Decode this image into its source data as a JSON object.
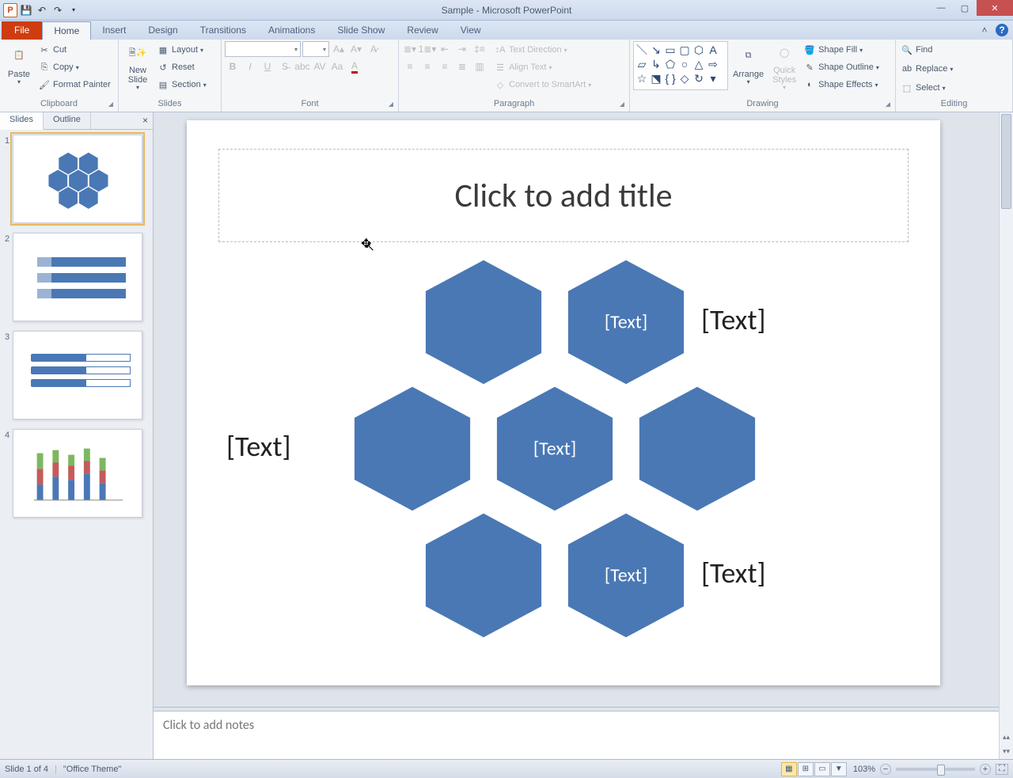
{
  "app": {
    "title": "Sample - Microsoft PowerPoint",
    "qat": {
      "save": "💾",
      "undo": "↶",
      "redo": "↷"
    }
  },
  "tabs": {
    "file": "File",
    "items": [
      "Home",
      "Insert",
      "Design",
      "Transitions",
      "Animations",
      "Slide Show",
      "Review",
      "View"
    ],
    "active": "Home"
  },
  "ribbon": {
    "clipboard": {
      "label": "Clipboard",
      "paste": "Paste",
      "cut": "Cut",
      "copy": "Copy",
      "formatpainter": "Format Painter"
    },
    "slides": {
      "label": "Slides",
      "newslide": "New\nSlide",
      "layout": "Layout",
      "reset": "Reset",
      "section": "Section"
    },
    "font": {
      "label": "Font"
    },
    "paragraph": {
      "label": "Paragraph",
      "textdir": "Text Direction",
      "align": "Align Text",
      "smartart": "Convert to SmartArt"
    },
    "drawing": {
      "label": "Drawing",
      "arrange": "Arrange",
      "quick": "Quick\nStyles",
      "fill": "Shape Fill",
      "outline": "Shape Outline",
      "effects": "Shape Effects"
    },
    "editing": {
      "label": "Editing",
      "find": "Find",
      "replace": "Replace",
      "select": "Select"
    }
  },
  "panel": {
    "slides_tab": "Slides",
    "outline_tab": "Outline",
    "thumbs": [
      "1",
      "2",
      "3",
      "4"
    ]
  },
  "slide": {
    "title_placeholder": "Click to add title",
    "hex_text": "[Text]",
    "side_text": "[Text]"
  },
  "notes": {
    "placeholder": "Click to add notes"
  },
  "status": {
    "slide_info": "Slide 1 of 4",
    "theme": "\"Office Theme\"",
    "zoom": "103%"
  },
  "colors": {
    "hex_fill": "#4a78b5",
    "hex_stroke": "#3a5f90"
  }
}
